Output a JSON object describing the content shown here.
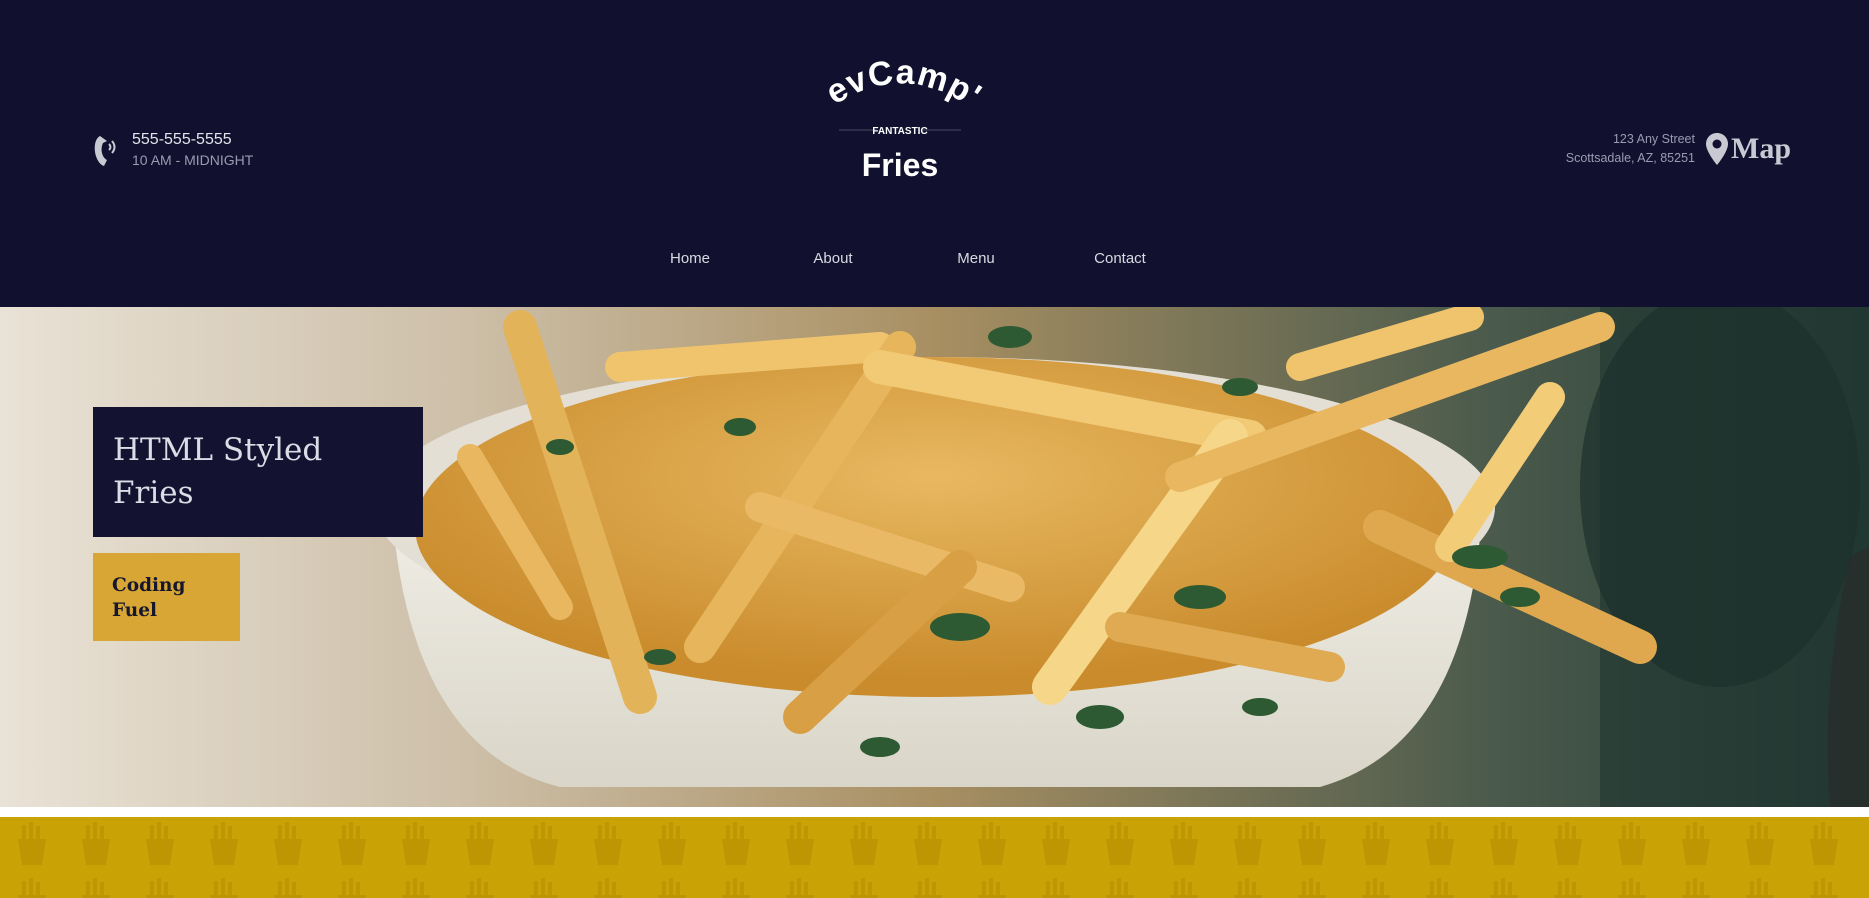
{
  "header": {
    "phone_number": "555-555-5555",
    "hours": "10 AM - MIDNIGHT",
    "phone_icon": "phone-icon",
    "address_line1": "123 Any Street",
    "address_line2": "Scottsadale, AZ, 85251",
    "map_icon": "map-pin-icon",
    "map_label": "Map",
    "background_color": "#11112f"
  },
  "logo": {
    "top_text": "DevCamp's",
    "middle_text": "FANTASTIC",
    "bottom_text": "Fries"
  },
  "nav": {
    "items": [
      {
        "label": "Home"
      },
      {
        "label": "About"
      },
      {
        "label": "Menu"
      },
      {
        "label": "Contact"
      }
    ]
  },
  "hero": {
    "title": "HTML Styled Fries",
    "tag": "Coding Fuel",
    "title_box_color": "#131331",
    "tag_box_color": "#d7a634"
  },
  "pattern_band": {
    "color": "#c9a205",
    "icon": "fries-pattern-icon"
  }
}
